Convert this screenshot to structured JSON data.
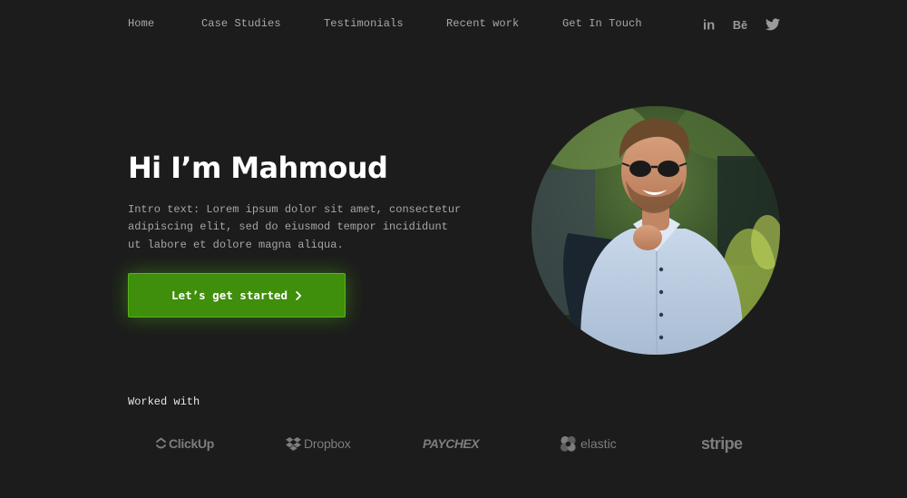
{
  "nav": {
    "links": [
      {
        "label": "Home"
      },
      {
        "label": "Case Studies"
      },
      {
        "label": "Testimonials"
      },
      {
        "label": "Recent work"
      },
      {
        "label": "Get In Touch"
      }
    ],
    "social": [
      "linkedin-icon",
      "behance-icon",
      "twitter-icon"
    ],
    "social_glyphs": {
      "linkedin": "in",
      "behance": "Bē"
    }
  },
  "hero": {
    "title": "Hi I’m Mahmoud",
    "intro": "Intro text: Lorem ipsum dolor sit amet, consectetur adipiscing elit, sed do eiusmod tempor incididunt ut labore et dolore magna aliqua.",
    "cta_label": "Let’s get started",
    "avatar": "portrait-photo"
  },
  "clients": {
    "label": "Worked with",
    "logos": [
      {
        "name": "ClickUp"
      },
      {
        "name": "Dropbox"
      },
      {
        "name": "PAYCHEX"
      },
      {
        "name": "elastic"
      },
      {
        "name": "stripe"
      }
    ]
  },
  "colors": {
    "background": "#1c1c1c",
    "accent": "#3f8e0c",
    "text_muted": "#a6a6a6",
    "logo_gray": "#7d7d7d"
  }
}
